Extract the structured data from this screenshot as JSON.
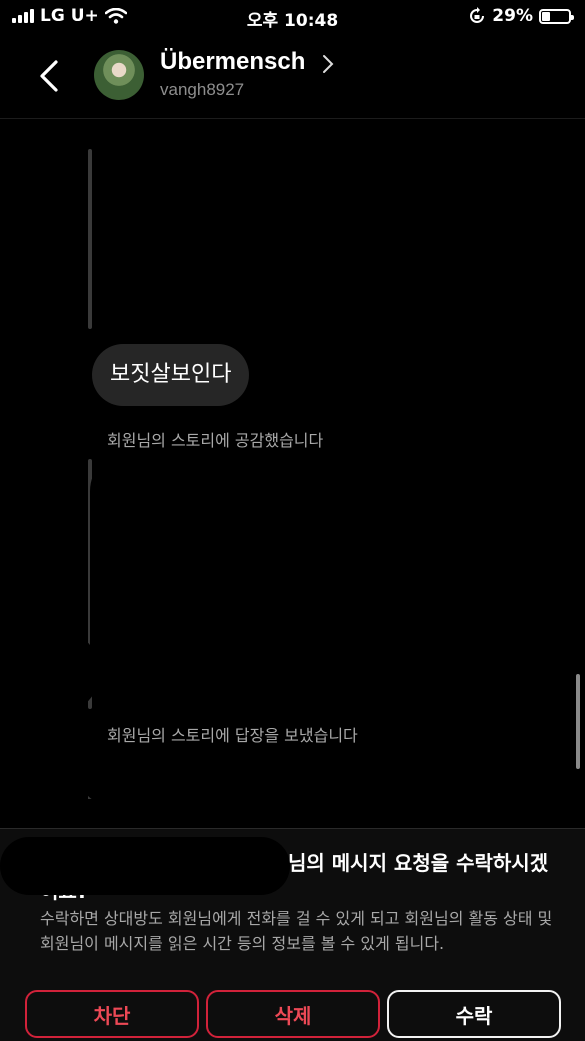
{
  "status_bar": {
    "carrier": "LG U+",
    "time": "오후 10:48",
    "battery_percent": "29%",
    "battery_level": 0.29,
    "icons": [
      "signal-icon",
      "wifi-icon",
      "orientation-lock-icon",
      "battery-icon"
    ]
  },
  "header": {
    "name": "Übermensch",
    "handle": "vangh8927",
    "icons": [
      "back-chevron-icon",
      "profile-chevron-icon"
    ]
  },
  "chat": {
    "messages": [
      {
        "type": "bubble",
        "text": "보짓살보인다"
      },
      {
        "type": "system",
        "text": "회원님의 스토리에 공감했습니다"
      },
      {
        "type": "system",
        "text": "회원님의 스토리에 답장을 보냈습니다"
      }
    ]
  },
  "request": {
    "title": "님의 메시지 요청을 수락하시겠어요?",
    "description": "수락하면 상대방도 회원님에게 전화를 걸 수 있게 되고 회원님의 활동 상태 및 회원님이 메시지를 읽은 시간 등의 정보를 볼 수 있게 됩니다.",
    "buttons": {
      "block": "차단",
      "delete": "삭제",
      "accept": "수락"
    }
  },
  "colors": {
    "background": "#000000",
    "danger": "#ed4956",
    "bubble": "#262626",
    "muted": "#a8a8a8"
  }
}
